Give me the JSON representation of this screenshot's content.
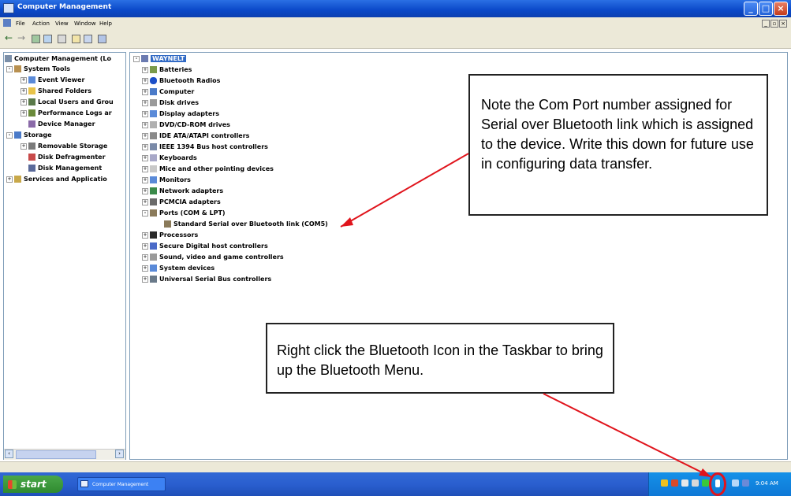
{
  "window": {
    "title": "Computer Management",
    "menu": [
      "File",
      "Action",
      "View",
      "Window",
      "Help"
    ]
  },
  "tree": {
    "root": "Computer Management (Lo",
    "system_tools": "System Tools",
    "event_viewer": "Event Viewer",
    "shared_folders": "Shared Folders",
    "local_users": "Local Users and Grou",
    "performance": "Performance Logs ar",
    "device_manager": "Device Manager",
    "storage": "Storage",
    "removable": "Removable Storage",
    "defrag": "Disk Defragmenter",
    "disk_mgmt": "Disk Management",
    "services": "Services and Applicatio"
  },
  "devices": {
    "computer_name": "WAYNELT",
    "categories": [
      "Batteries",
      "Bluetooth Radios",
      "Computer",
      "Disk drives",
      "Display adapters",
      "DVD/CD-ROM drives",
      "IDE ATA/ATAPI controllers",
      "IEEE 1394 Bus host controllers",
      "Keyboards",
      "Mice and other pointing devices",
      "Monitors",
      "Network adapters",
      "PCMCIA adapters",
      "Ports (COM & LPT)",
      "Standard Serial over Bluetooth link (COM5)",
      "Processors",
      "Secure Digital host controllers",
      "Sound, video and game controllers",
      "System devices",
      "Universal Serial Bus controllers"
    ]
  },
  "callouts": {
    "com_port_note": "Note the Com Port number assigned for Serial over Bluetooth link which is assigned to the device.  Write this down for future use in configuring data transfer.",
    "bluetooth_note": "Right click the Bluetooth Icon in the Taskbar to bring up the Bluetooth Menu."
  },
  "taskbar": {
    "start_label": "start",
    "task_label": "Computer Management",
    "clock": "9:04 AM"
  },
  "colors": {
    "titlebar": "#0a48c8",
    "taskbar": "#2a5fcf",
    "start": "#3a9a3a",
    "selection": "#316ac5",
    "annotation_red": "#e0141c"
  }
}
